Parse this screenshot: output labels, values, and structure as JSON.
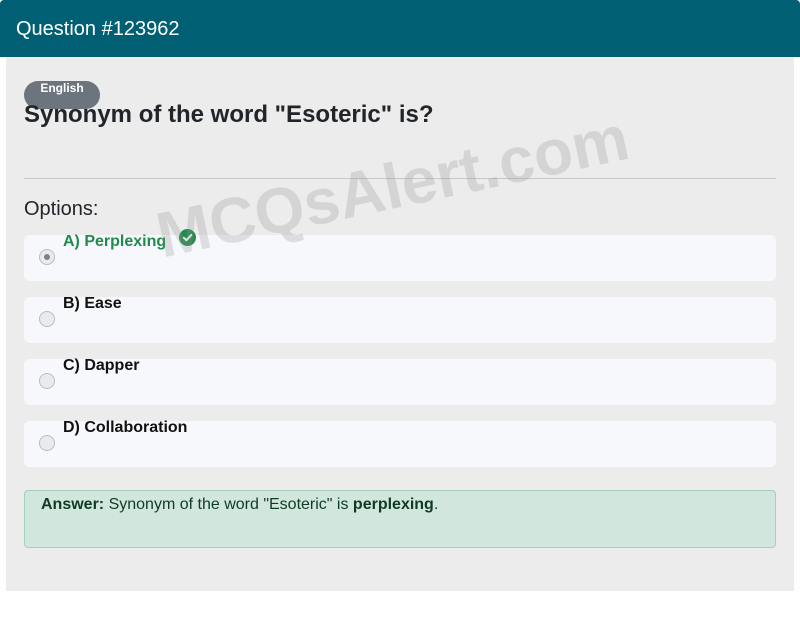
{
  "header": {
    "title": "Question #123962"
  },
  "question": {
    "language_badge": "English",
    "text": "Synonym of the word \"Esoteric\" is?"
  },
  "options_label": "Options:",
  "options": [
    {
      "label": "A) Perplexing",
      "selected": true,
      "correct": true
    },
    {
      "label": "B) Ease",
      "selected": false,
      "correct": false
    },
    {
      "label": "C) Dapper",
      "selected": false,
      "correct": false
    },
    {
      "label": "D) Collaboration",
      "selected": false,
      "correct": false
    }
  ],
  "answer": {
    "prefix": "Answer:",
    "text": " Synonym of the word \"Esoteric\" is ",
    "highlight": "perplexing",
    "suffix": "."
  },
  "watermark": "MCQsAlert.com",
  "colors": {
    "header_bg": "#005f73",
    "correct_green": "#218a4c",
    "answer_bg": "#d1e7dd"
  }
}
